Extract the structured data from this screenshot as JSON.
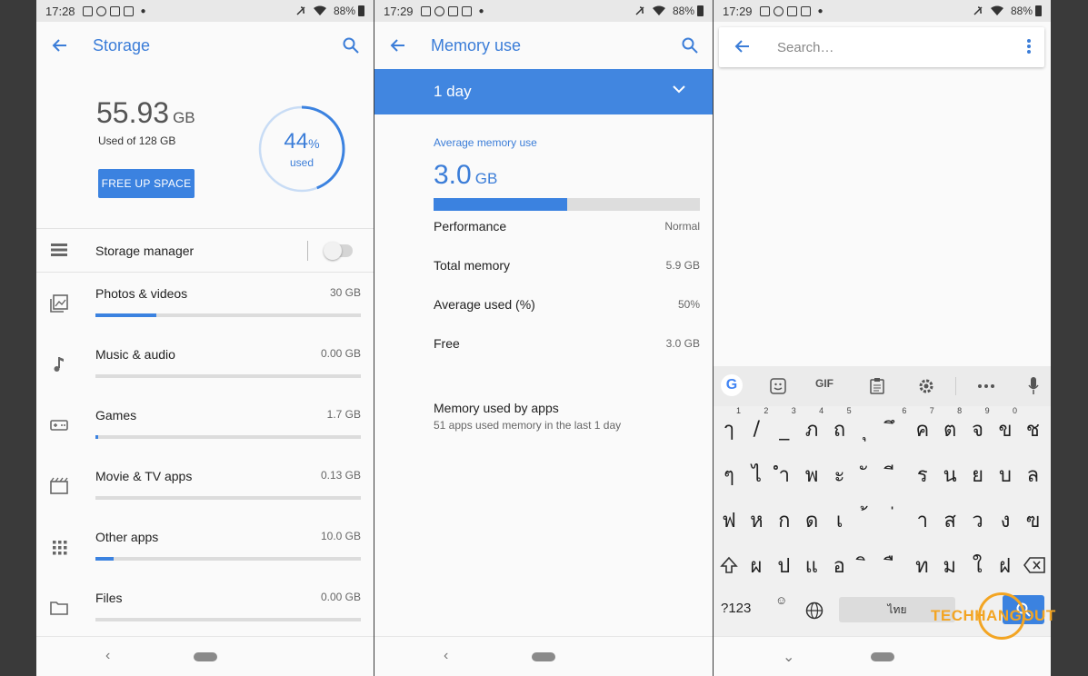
{
  "status": [
    {
      "time": "17:28",
      "battery": "88%"
    },
    {
      "time": "17:29",
      "battery": "88%"
    },
    {
      "time": "17:29",
      "battery": "88%"
    }
  ],
  "storage": {
    "title": "Storage",
    "used_value": "55.93",
    "used_unit": "GB",
    "used_of": "Used of 128 GB",
    "free_button": "FREE UP SPACE",
    "percent": "44",
    "percent_sign": "%",
    "percent_label": "used",
    "percent_fraction": 0.44,
    "manager_label": "Storage manager",
    "categories": [
      {
        "name": "Photos & videos",
        "size": "30 GB",
        "fraction": 0.23,
        "icon": "photos-icon"
      },
      {
        "name": "Music & audio",
        "size": "0.00 GB",
        "fraction": 0.0,
        "icon": "music-note-icon"
      },
      {
        "name": "Games",
        "size": "1.7 GB",
        "fraction": 0.01,
        "icon": "gamepad-icon"
      },
      {
        "name": "Movie & TV apps",
        "size": "0.13 GB",
        "fraction": 0.0,
        "icon": "movie-icon"
      },
      {
        "name": "Other apps",
        "size": "10.0 GB",
        "fraction": 0.07,
        "icon": "apps-grid-icon"
      },
      {
        "name": "Files",
        "size": "0.00 GB",
        "fraction": 0.0,
        "icon": "folder-icon"
      }
    ]
  },
  "memory": {
    "title": "Memory use",
    "period": "1 day",
    "avg_label": "Average memory use",
    "avg_value": "3.0",
    "avg_unit": "GB",
    "avg_fraction": 0.5,
    "rows": [
      {
        "key": "Performance",
        "value": "Normal"
      },
      {
        "key": "Total memory",
        "value": "5.9 GB"
      },
      {
        "key": "Average used (%)",
        "value": "50%"
      },
      {
        "key": "Free",
        "value": "3.0 GB"
      }
    ],
    "apps_title": "Memory used by apps",
    "apps_sub": "51 apps used memory in the last 1 day"
  },
  "search": {
    "placeholder": "Search…",
    "toolbar": {
      "gif": "GIF",
      "google": "G"
    },
    "rows": [
      {
        "keys": [
          "ๅ",
          "/",
          "_",
          "ภ",
          "ถ",
          "ุ",
          "ึ",
          "ค",
          "ต",
          "จ",
          "ข",
          "ช"
        ],
        "hints": [
          "1",
          "2",
          "3",
          "4",
          "5",
          "",
          "6",
          "7",
          "8",
          "9",
          "0",
          ""
        ]
      },
      {
        "keys": [
          "ๆ",
          "ไ",
          "ำ",
          "พ",
          "ะ",
          "ั",
          "ี",
          "ร",
          "น",
          "ย",
          "บ",
          "ล"
        ]
      },
      {
        "keys": [
          "ฟ",
          "ห",
          "ก",
          "ด",
          "เ",
          "้",
          "่",
          "า",
          "ส",
          "ว",
          "ง",
          "ฃ"
        ]
      },
      {
        "keys": [
          "ผ",
          "ป",
          "แ",
          "อ",
          "ิ",
          "ื",
          "ท",
          "ม",
          "ใ",
          "ฝ"
        ]
      }
    ],
    "symbols_key": "?123",
    "space_label": "ไทย"
  },
  "watermark": "TECHHANGOUT",
  "colors": {
    "accent": "#3b82e0",
    "brand_orange": "#f3a523"
  }
}
